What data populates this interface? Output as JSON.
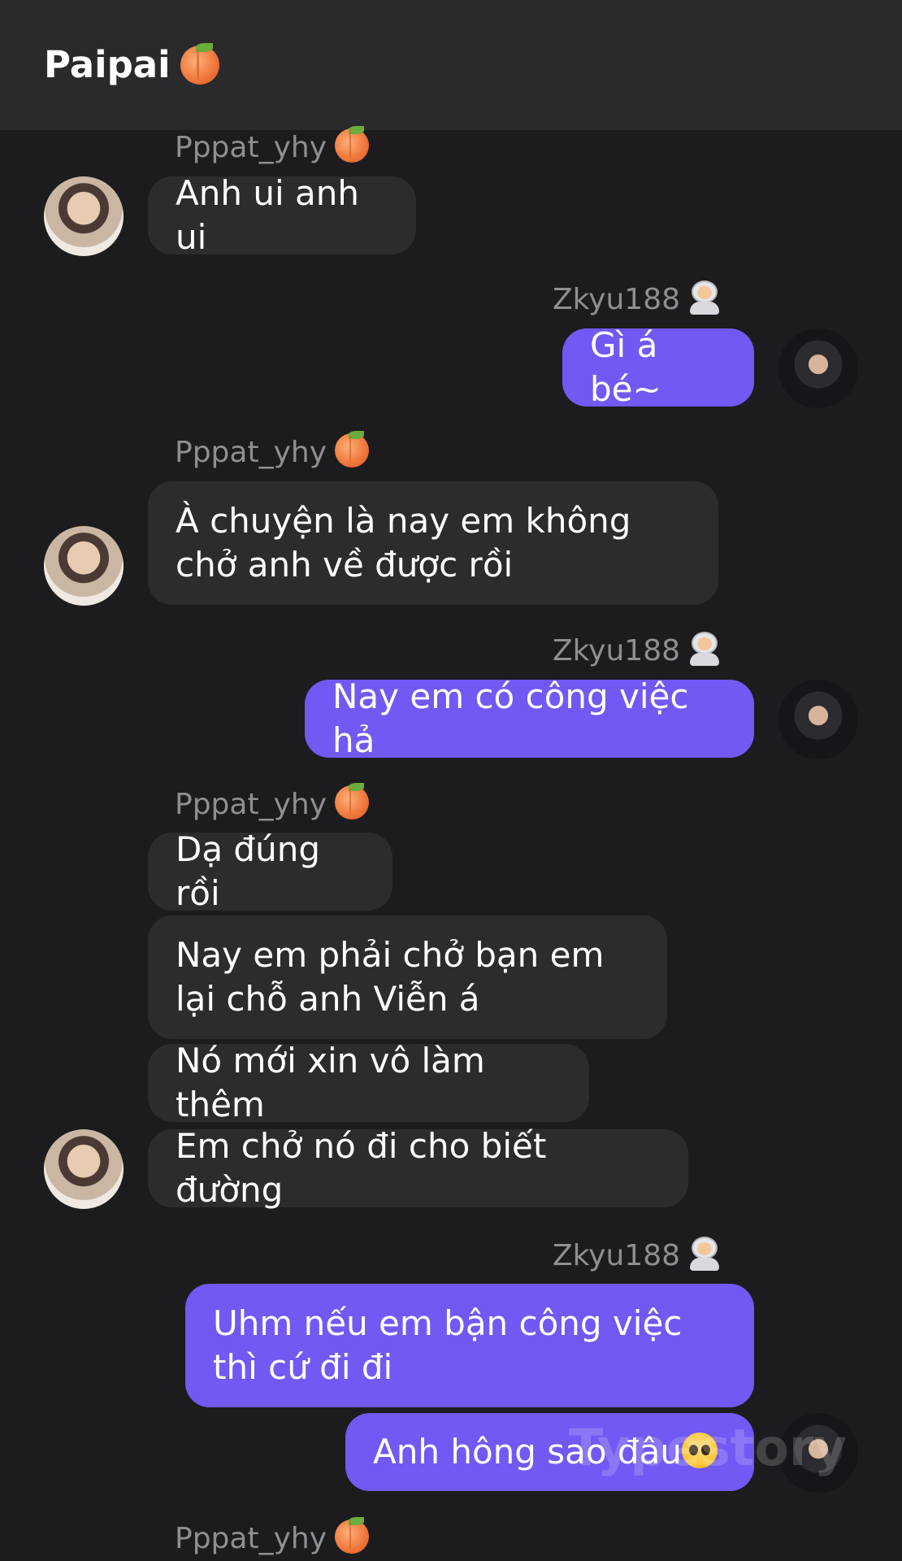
{
  "header": {
    "title": "Paipai",
    "title_emoji": "peach-emoji"
  },
  "senders": {
    "other": "Pppat_yhy",
    "me": "Zkyu188"
  },
  "messages": [
    {
      "text": "Anh ui anh ui"
    },
    {
      "text": "Gì á bé~"
    },
    {
      "text": "À chuyện là nay em không chở anh về được rồi"
    },
    {
      "text": "Nay em có công việc hả"
    },
    {
      "text": "Dạ đúng rồi"
    },
    {
      "text": "Nay em phải chở bạn em lại chỗ anh Viễn á"
    },
    {
      "text": "Nó mới xin vô làm thêm"
    },
    {
      "text": "Em chở nó đi cho biết đường"
    },
    {
      "text": "Uhm nếu em bận công việc thì cứ đi đi"
    },
    {
      "text": "Anh hông sao đâu"
    }
  ],
  "watermark": "Typestory",
  "colors": {
    "background": "#1c1c1e",
    "header": "#2a2a2c",
    "incoming": "#2c2c2e",
    "outgoing": "#7159f3",
    "sender": "#8e8e93"
  }
}
